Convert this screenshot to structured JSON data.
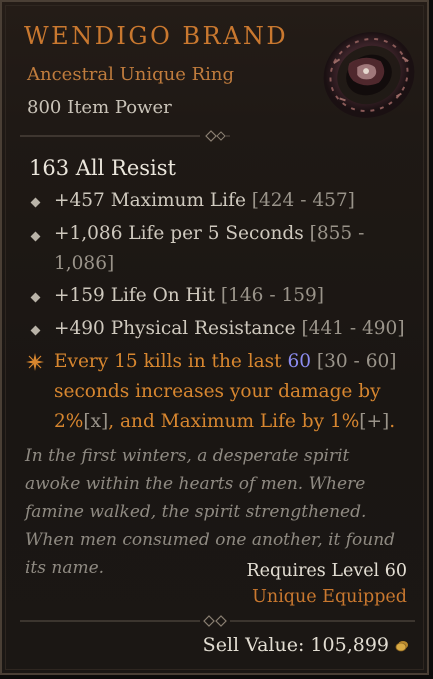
{
  "item": {
    "name": "WENDIGO BRAND",
    "type": "Ancestral Unique Ring",
    "item_power": "800 Item Power",
    "icon": "ring-icon"
  },
  "implicit": "163 All Resist",
  "affixes": [
    {
      "text": "+457 Maximum Life",
      "range": "[424 - 457]"
    },
    {
      "text": "+1,086 Life per 5 Seconds",
      "range": "[855 - 1,086]"
    },
    {
      "text": "+159 Life On Hit",
      "range": "[146 - 159]"
    },
    {
      "text": "+490 Physical Resistance",
      "range": "[441 - 490]"
    }
  ],
  "unique_power": {
    "part1": "Every 15 kills in the last ",
    "value": "60",
    "range": "[30 - 60]",
    "part2": "seconds increases your damage by 2%",
    "mark1": "[x]",
    "part3": ", and Maximum Life by 1%",
    "mark2": "[+]",
    "part4": "."
  },
  "flavor_text": "In the first winters, a desperate spirit awoke within the hearts of men. Where famine walked, the spirit strengthened. When men consumed one another, it found its name.",
  "requirements": "Requires Level 60",
  "status": "Unique Equipped",
  "sell_value": "Sell Value: 105,899",
  "colors": {
    "unique": "#c9782f",
    "highlight": "#8c8cf0",
    "text": "#cfc9be",
    "flavor": "#8f8a82"
  }
}
